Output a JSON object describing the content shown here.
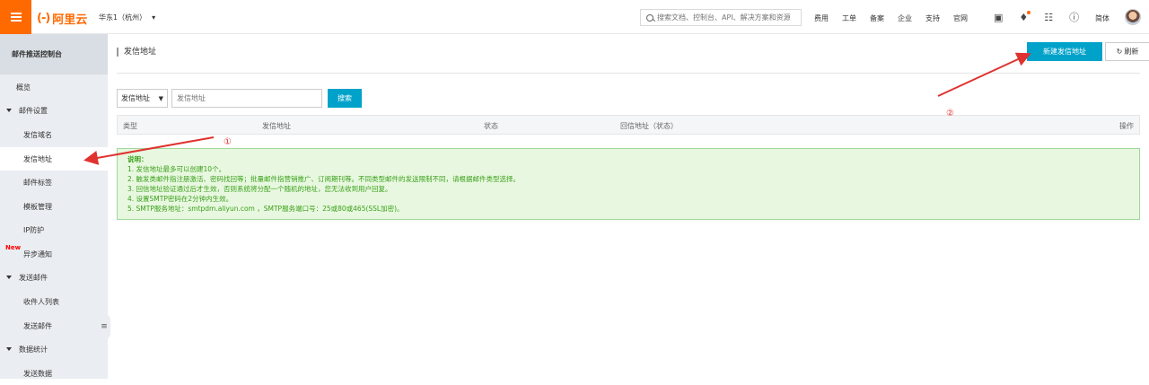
{
  "topbar": {
    "logo_mark": "(-)",
    "logo_text": "阿里云",
    "region": "华东1（杭州）",
    "region_caret": "▾",
    "search_placeholder": "搜索文档、控制台、API、解决方案和资源",
    "nav": [
      "费用",
      "工单",
      "备案",
      "企业",
      "支持",
      "官网"
    ],
    "icons": [
      "terminal-icon",
      "bell-icon",
      "cart-icon",
      "help-icon"
    ],
    "lang": "简体"
  },
  "sidebar": {
    "title": "邮件推送控制台",
    "overview": "概览",
    "group_mail_settings": "邮件设置",
    "sender_domain": "发信域名",
    "sender_address": "发信地址",
    "mail_tags": "邮件标签",
    "template_mgmt": "模板管理",
    "ip_protect": "IP防护",
    "new_badge": "New",
    "async_notify": "异步通知",
    "group_send_mail": "发送邮件",
    "recipient_list": "收件人列表",
    "send_mail": "发送邮件",
    "group_stats": "数据统计",
    "send_data": "发送数据"
  },
  "main": {
    "page_title": "发信地址",
    "new_button": "新建发信地址",
    "refresh_button": "刷新",
    "filter_select": "发信地址",
    "filter_placeholder": "发信地址",
    "search_button": "搜索",
    "columns": [
      "类型",
      "发信地址",
      "状态",
      "回信地址（状态）",
      "操作"
    ],
    "notice": {
      "title": "说明：",
      "lines": [
        "1. 发信地址最多可以创建10个。",
        "2. 触发类邮件指注册激活、密码找回等；批量邮件指营销推广、订阅期刊等。不同类型邮件的发送限制不同，请根据邮件类型选择。",
        "3. 回信地址验证通过后才生效，否则系统将分配一个随机的地址，您无法收到用户回复。",
        "4. 设置SMTP密码在2分钟内生效。",
        "5. SMTP服务地址：smtpdm.aliyun.com ，SMTP服务端口号：25或80或465(SSL加密)。"
      ]
    }
  },
  "annotations": {
    "marker_1": "①",
    "marker_2": "②",
    "color": "#e0322f"
  },
  "colors": {
    "brand": "#ff6a00",
    "primary": "#00a2ca",
    "notice_bg": "#e8f8e0",
    "notice_text": "#3aa01a"
  }
}
